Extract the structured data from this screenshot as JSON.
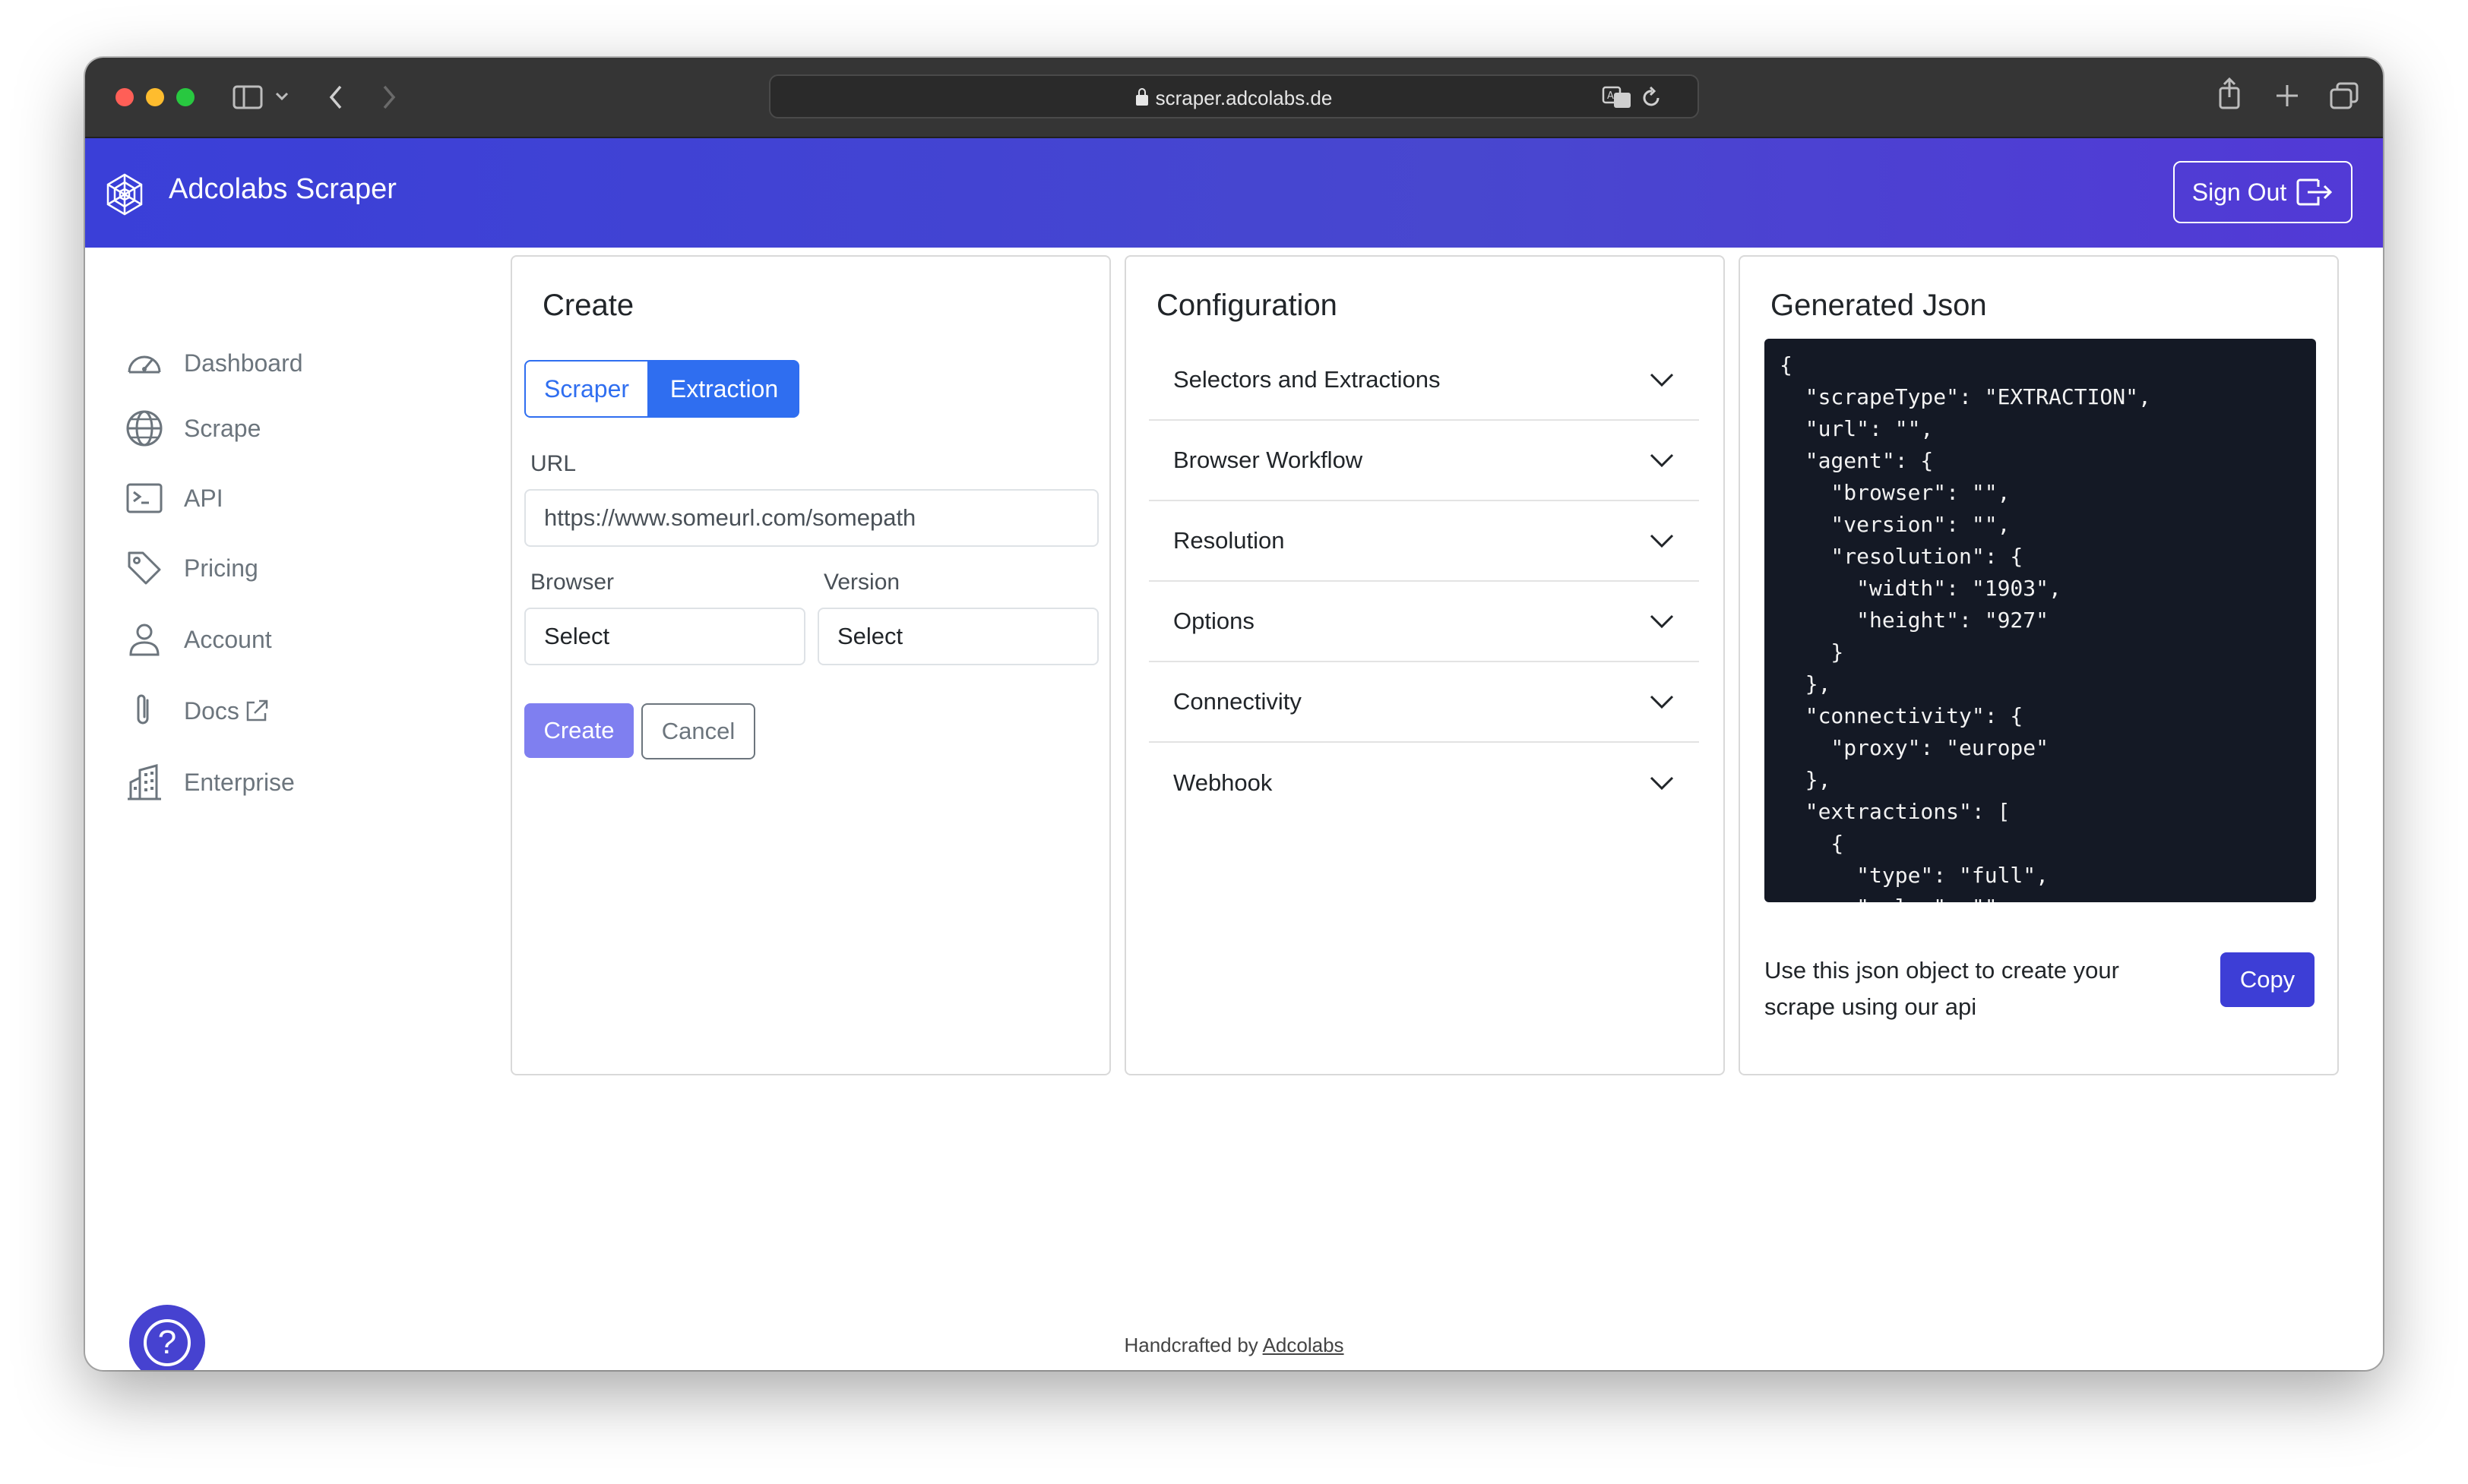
{
  "browser": {
    "address": "scraper.adcolabs.de"
  },
  "header": {
    "brand": "Adcolabs Scraper",
    "sign_out_label": "Sign Out"
  },
  "sidebar": {
    "items": [
      {
        "label": "Dashboard",
        "icon": "speedometer-icon"
      },
      {
        "label": "Scrape",
        "icon": "globe-icon"
      },
      {
        "label": "API",
        "icon": "terminal-icon"
      },
      {
        "label": "Pricing",
        "icon": "tag-icon"
      },
      {
        "label": "Account",
        "icon": "person-icon"
      },
      {
        "label": "Docs",
        "icon": "paperclip-icon"
      },
      {
        "label": "Enterprise",
        "icon": "building-icon"
      }
    ]
  },
  "create": {
    "title": "Create",
    "tab_scraper": "Scraper",
    "tab_extraction": "Extraction",
    "active_tab": "Extraction",
    "url_label": "URL",
    "url_placeholder": "https://www.someurl.com/somepath",
    "browser_label": "Browser",
    "browser_value": "Select",
    "version_label": "Version",
    "version_value": "Select",
    "create_label": "Create",
    "cancel_label": "Cancel"
  },
  "configuration": {
    "title": "Configuration",
    "sections": [
      "Selectors and Extractions",
      "Browser Workflow",
      "Resolution",
      "Options",
      "Connectivity",
      "Webhook"
    ]
  },
  "generated": {
    "title": "Generated Json",
    "json_text": "{\n  \"scrapeType\": \"EXTRACTION\",\n  \"url\": \"\",\n  \"agent\": {\n    \"browser\": \"\",\n    \"version\": \"\",\n    \"resolution\": {\n      \"width\": \"1903\",\n      \"height\": \"927\"\n    }\n  },\n  \"connectivity\": {\n    \"proxy\": \"europe\"\n  },\n  \"extractions\": [\n    {\n      \"type\": \"full\",\n      \"value\": \"\"",
    "description": "Use this json object to create your scrape using our api",
    "copy_label": "Copy"
  },
  "footer": {
    "prefix": "Handcrafted by",
    "link": "Adcolabs"
  },
  "colors": {
    "accent": "#2f6ef0",
    "header_start": "#3a3fd8",
    "header_end": "#5239d6",
    "json_bg": "#141925",
    "copy_button": "#3d3ed6"
  }
}
